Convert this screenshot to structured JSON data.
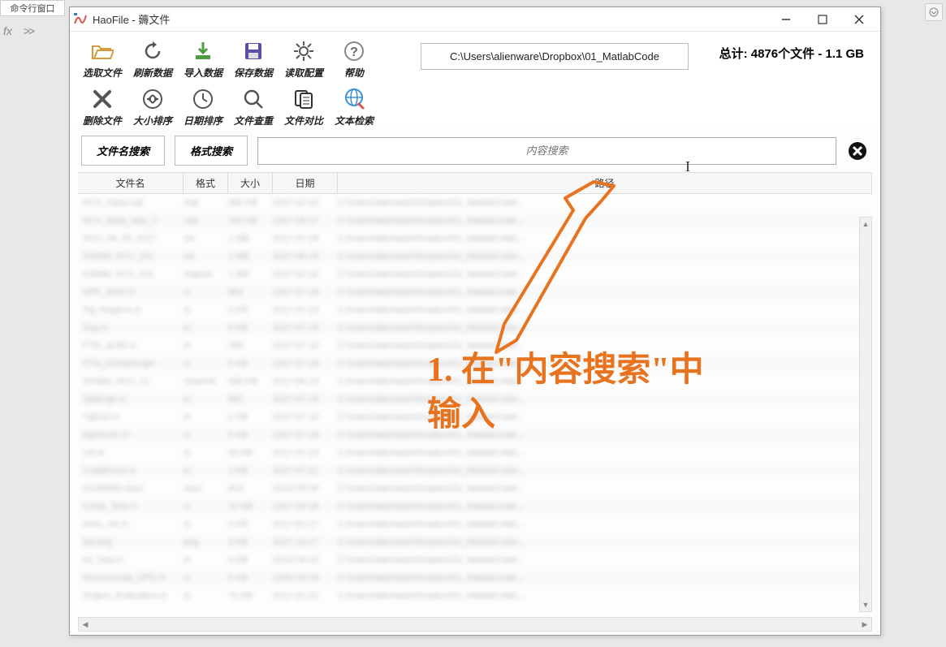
{
  "background": {
    "tab_label": "命令行窗口",
    "fx_label": "fx",
    "prompt": ">>"
  },
  "window": {
    "title": "HaoFile - 薅文件",
    "path": "C:\\Users\\alienware\\Dropbox\\01_MatlabCode",
    "summary_prefix": "总计: ",
    "summary_count": "4876",
    "summary_mid": "个文件 - ",
    "summary_size": "1.1 GB"
  },
  "toolbar1": {
    "select_file": "选取文件",
    "refresh": "刷新数据",
    "import": "导入数据",
    "save": "保存数据",
    "read_config": "读取配置",
    "help": "帮助"
  },
  "toolbar2": {
    "delete_file": "删除文件",
    "size_sort": "大小排序",
    "date_sort": "日期排序",
    "file_dedup": "文件查重",
    "file_compare": "文件对比",
    "text_search": "文本检索"
  },
  "search": {
    "filename_btn": "文件名搜索",
    "format_btn": "格式搜索",
    "content_placeholder": "内容搜索"
  },
  "columns": {
    "name": "文件名",
    "format": "格式",
    "size": "大小",
    "date": "日期",
    "path": "路径"
  },
  "annotation": {
    "line1": "1. 在\"内容搜索\"中",
    "line2": "输入"
  },
  "blur_rows": [
    {
      "n": "HCV_Data.mat",
      "f": "mat",
      "s": "582 KB",
      "d": "2017-02-10",
      "p": "C:\\Users\\alienware\\Dropbox\\01_MatlabCode\\..."
    },
    {
      "n": "HCV_Data_new_2",
      "f": "mat",
      "s": "316 KB",
      "d": "2017-08-17",
      "p": "C:\\Users\\alienware\\Dropbox\\01_MatlabCode\\..."
    },
    {
      "n": "HCV_06_25_2017",
      "f": "xls",
      "s": "1 MB",
      "d": "2017-07-18",
      "p": "C:\\Users\\alienware\\Dropbox\\01_MatlabCode\\..."
    },
    {
      "n": "SGMM_HCV_201",
      "f": "xls",
      "s": "1 MB",
      "d": "2017-06-19",
      "p": "C:\\Users\\alienware\\Dropbox\\01_MatlabCode\\..."
    },
    {
      "n": "SGMM_HCV_201",
      "f": "original",
      "s": "1 MB",
      "d": "2017-02-16",
      "p": "C:\\Users\\alienware\\Dropbox\\01_MatlabCode\\..."
    },
    {
      "n": "APP_2016.m",
      "f": "m",
      "s": "862",
      "d": "2017-07-19",
      "p": "C:\\Users\\alienware\\Dropbox\\01_MatlabCode\\..."
    },
    {
      "n": "Fig_Regens.m",
      "f": "m",
      "s": "2 KB",
      "d": "2017-07-19",
      "p": "C:\\Users\\alienware\\Dropbox\\01_MatlabCode\\..."
    },
    {
      "n": "Svg.m",
      "f": "m",
      "s": "6 KB",
      "d": "2017-07-19",
      "p": "C:\\Users\\alienware\\Dropbox\\01_MatlabCode\\..."
    },
    {
      "n": "FTN_qC06.m",
      "f": "m",
      "s": "349",
      "d": "2017-07-19",
      "p": "C:\\Users\\alienware\\Dropbox\\01_MatlabCode\\..."
    },
    {
      "n": "FTN_nChartAngm",
      "f": "m",
      "s": "6 KB",
      "d": "2017-07-19",
      "p": "C:\\Users\\alienware\\Dropbox\\01_MatlabCode\\..."
    },
    {
      "n": "SGMM_HCV_21",
      "f": "mean06",
      "s": "580 KB",
      "d": "2017-06-19",
      "p": "C:\\Users\\alienware\\Dropbox\\01_MatlabCode\\..."
    },
    {
      "n": "SpiEnge.m",
      "f": "m",
      "s": "862",
      "d": "2017-07-19",
      "p": "C:\\Users\\alienware\\Dropbox\\01_MatlabCode\\..."
    },
    {
      "n": "TgEnd.m",
      "f": "m",
      "s": "2 KB",
      "d": "2017-07-19",
      "p": "C:\\Users\\alienware\\Dropbox\\01_MatlabCode\\..."
    },
    {
      "n": "trgsensm.m",
      "f": "m",
      "s": "5 KB",
      "d": "2017-07-19",
      "p": "C:\\Users\\alienware\\Dropbox\\01_MatlabCode\\..."
    },
    {
      "n": "U6.m",
      "f": "m",
      "s": "36 KB",
      "d": "2017-07-19",
      "p": "C:\\Users\\alienware\\Dropbox\\01_MatlabCode\\..."
    },
    {
      "n": "CodeExcel.m",
      "f": "m",
      "s": "1 KB",
      "d": "2017-07-21",
      "p": "C:\\Users\\alienware\\Dropbox\\01_MatlabCode\\..."
    },
    {
      "n": "20190509.docx",
      "f": "docx",
      "s": "803",
      "d": "2019-05-09",
      "p": "C:\\Users\\alienware\\Dropbox\\01_MatlabCode\\..."
    },
    {
      "n": "Costs_Test.m",
      "f": "m",
      "s": "10 KB",
      "d": "2017-02-18",
      "p": "C:\\Users\\alienware\\Dropbox\\01_MatlabCode\\..."
    },
    {
      "n": "Aero_ctrl.m",
      "f": "m",
      "s": "3 KB",
      "d": "2017-02-17",
      "p": "C:\\Users\\alienware\\Dropbox\\01_MatlabCode\\..."
    },
    {
      "n": "twt.png",
      "f": "png",
      "s": "3 KB",
      "d": "2017-12-17",
      "p": "C:\\Users\\alienware\\Dropbox\\01_MatlabCode\\..."
    },
    {
      "n": "txt_Test.m",
      "f": "m",
      "s": "3 KB",
      "d": "2018-06-23",
      "p": "C:\\Users\\alienware\\Dropbox\\01_MatlabCode\\..."
    },
    {
      "n": "SourceCode_DPS.m",
      "f": "m",
      "s": "6 KB",
      "d": "2020-02-19",
      "p": "C:\\Users\\alienware\\Dropbox\\01_MatlabCode\\..."
    },
    {
      "n": "Project_Evaluation.m",
      "f": "m",
      "s": "72 KB",
      "d": "2017-01-21",
      "p": "C:\\Users\\alienware\\Dropbox\\01_MatlabCode\\..."
    }
  ]
}
